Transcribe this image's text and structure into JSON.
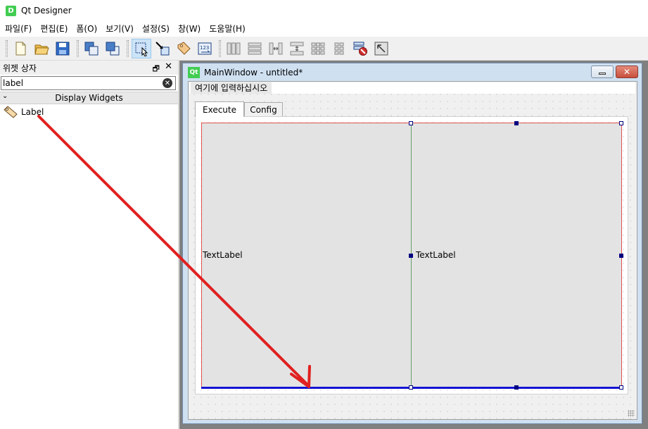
{
  "app": {
    "title": "Qt Designer",
    "icon_letter": "D"
  },
  "menubar": {
    "items": [
      "파일(F)",
      "편집(E)",
      "폼(O)",
      "보기(V)",
      "설정(S)",
      "창(W)",
      "도움말(H)"
    ]
  },
  "toolbar": {
    "buttons": [
      {
        "name": "new-form-icon"
      },
      {
        "name": "open-form-icon"
      },
      {
        "name": "save-form-icon"
      },
      {
        "name": "send-to-back-icon"
      },
      {
        "name": "bring-to-front-icon"
      },
      {
        "name": "edit-widgets-icon",
        "active": true
      },
      {
        "name": "edit-signals-slots-icon"
      },
      {
        "name": "edit-buddies-icon"
      },
      {
        "name": "edit-tab-order-icon"
      },
      {
        "name": "layout-horizontal-icon"
      },
      {
        "name": "layout-vertical-icon"
      },
      {
        "name": "layout-horizontal-splitter-icon"
      },
      {
        "name": "layout-vertical-splitter-icon"
      },
      {
        "name": "layout-grid-icon"
      },
      {
        "name": "layout-form-icon"
      },
      {
        "name": "break-layout-icon"
      },
      {
        "name": "adjust-size-icon"
      }
    ]
  },
  "widget_box": {
    "title": "위젯 상자",
    "float_glyph": "🗗",
    "close_glyph": "✕",
    "filter_value": "label",
    "clear_glyph": "✕",
    "category": "Display Widgets",
    "category_chevron": "⌄",
    "widgets": [
      {
        "label": "Label",
        "icon": "label-tag-icon"
      }
    ]
  },
  "form_window": {
    "title": "MainWindow - untitled*",
    "icon_text": "Qt",
    "close_glyph": "✕",
    "menu_placeholder": "여기에 입력하십시오",
    "tabs": [
      "Execute",
      "Config"
    ],
    "active_tab": 0,
    "labels": [
      "TextLabel",
      "TextLabel"
    ]
  },
  "colors": {
    "layout_border": "#e05050",
    "drop_indicator": "#1414d2",
    "annotation_arrow": "#e02020",
    "selection_handle": "#000080"
  }
}
